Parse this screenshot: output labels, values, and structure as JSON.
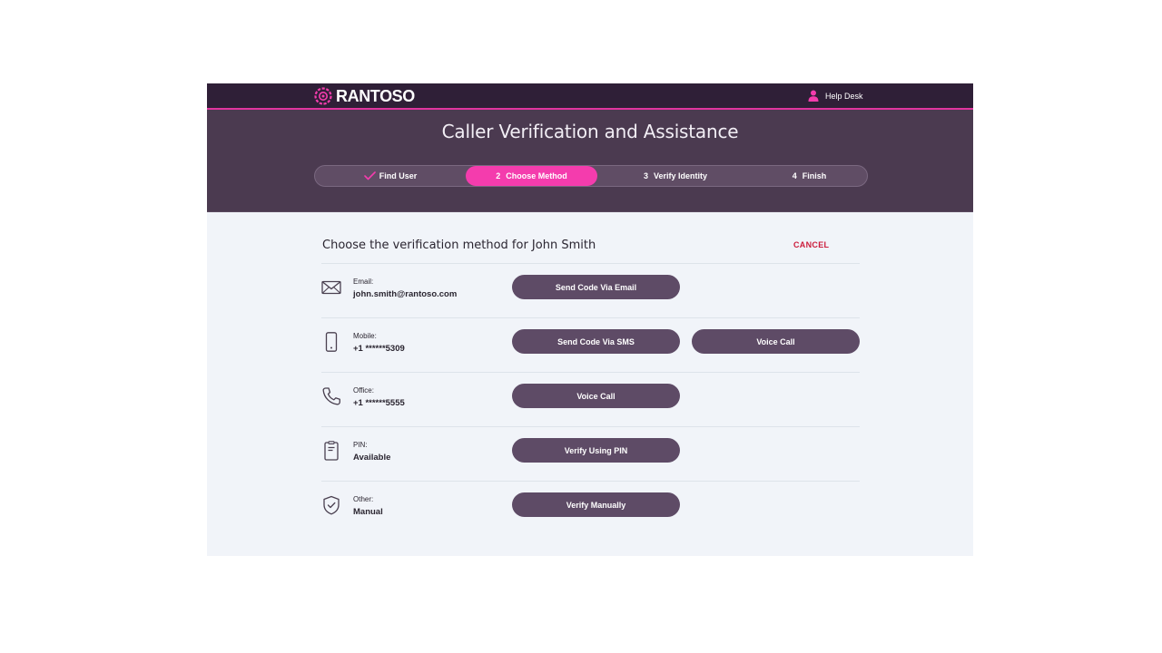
{
  "app": {
    "brand": "RANTOSO",
    "user_menu": {
      "label": "Help Desk",
      "icon": "user-icon"
    },
    "title": "Caller Verification and Assistance",
    "accent": "#f43cad",
    "steps": [
      {
        "num": "",
        "label": "Find User",
        "state": "done",
        "icon": "check-icon"
      },
      {
        "num": "2",
        "label": "Choose Method",
        "state": "active"
      },
      {
        "num": "3",
        "label": "Verify Identity",
        "state": "pending"
      },
      {
        "num": "4",
        "label": "Finish",
        "state": "pending"
      }
    ]
  },
  "content": {
    "prompt": "Choose the verification method for John Smith",
    "cancel_label": "CANCEL",
    "methods": [
      {
        "icon": "envelope-icon",
        "label": "Email:",
        "value": "john.smith@rantoso.com",
        "buttons": [
          "Send Code Via Email"
        ]
      },
      {
        "icon": "mobile-phone-icon",
        "label": "Mobile:",
        "value": "+1 ******5309",
        "buttons": [
          "Send Code Via SMS",
          "Voice Call"
        ]
      },
      {
        "icon": "phone-handset-icon",
        "label": "Office:",
        "value": "+1 ******5555",
        "buttons": [
          "Voice Call"
        ]
      },
      {
        "icon": "pin-card-icon",
        "label": "PIN:",
        "value": "Available",
        "buttons": [
          "Verify Using PIN"
        ]
      },
      {
        "icon": "shield-check-icon",
        "label": "Other:",
        "value": "Manual",
        "buttons": [
          "Verify Manually"
        ]
      }
    ]
  }
}
